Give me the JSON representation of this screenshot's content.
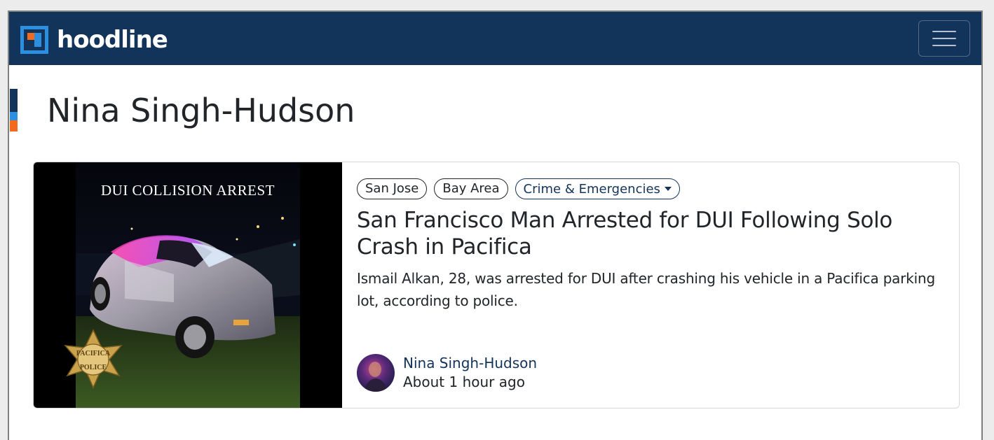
{
  "header": {
    "logo_text": "hoodline",
    "menu_icon": "hamburger-menu-icon",
    "colors": {
      "navbar": "#12335a",
      "logo_orange": "#f26b1d",
      "logo_blue": "#2d8fe0"
    }
  },
  "page": {
    "title": "Nina Singh-Hudson"
  },
  "article": {
    "image_caption": "DUI COLLISION ARREST",
    "badge_text_top": "PACIFICA",
    "badge_text_bottom": "POLICE",
    "tags": [
      {
        "label": "San Jose"
      },
      {
        "label": "Bay Area"
      },
      {
        "label": "Crime & Emergencies"
      }
    ],
    "headline": "San Francisco Man Arrested for DUI Following Solo Crash in Pacifica",
    "summary": "Ismail Alkan, 28, was arrested for DUI after crashing his vehicle in a Pacifica parking lot, according to police.",
    "author": {
      "name": "Nina Singh-Hudson",
      "timestamp": "About 1 hour ago"
    }
  }
}
